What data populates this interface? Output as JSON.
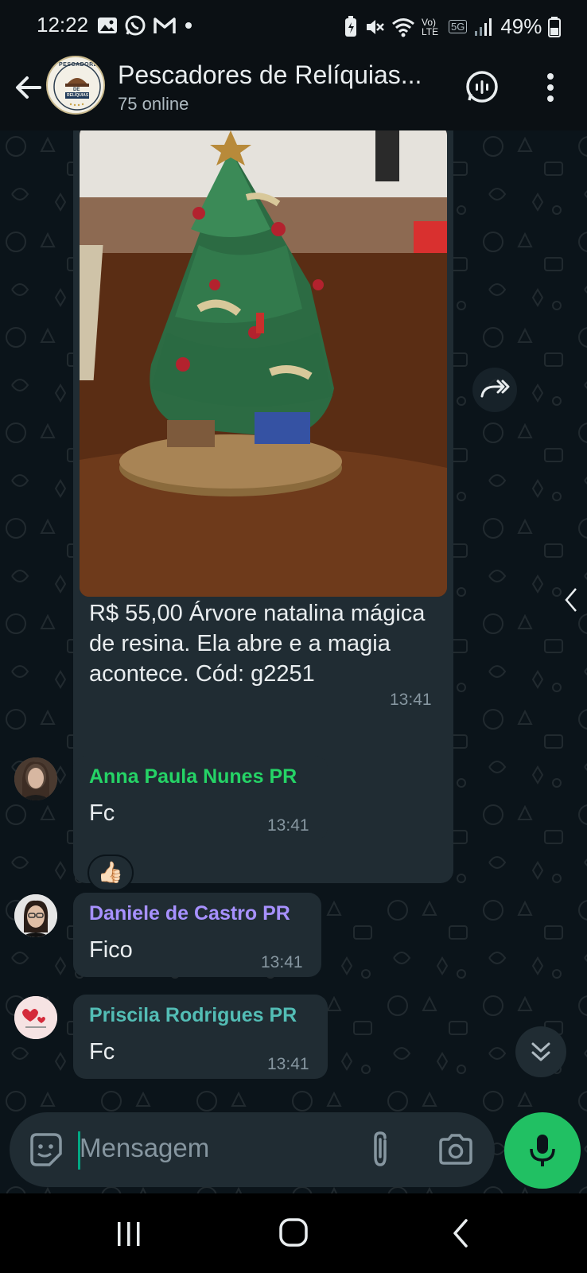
{
  "status_bar": {
    "time": "12:22",
    "battery": "49%",
    "network": "5G",
    "volte": "Vo) LTE"
  },
  "header": {
    "title": "Pescadores de Relíquias...",
    "subtitle": "75 online",
    "avatar_text_top": "PESCADORES",
    "avatar_text_mid": "DE",
    "avatar_text_bot": "RELÍQUIAS"
  },
  "messages": [
    {
      "type": "image",
      "caption": "R$ 55,00 Árvore natalina mágica de resina. Ela abre e a magia acontece.  Cód: g2251",
      "time": "13:41"
    },
    {
      "sender": "Anna Paula Nunes PR",
      "sender_color": "#25d366",
      "text": "Fc",
      "time": "13:41",
      "reaction": "👍🏻"
    },
    {
      "sender": "Daniele de Castro PR",
      "sender_color": "#a791ff",
      "text": "Fico",
      "time": "13:41"
    },
    {
      "sender": "Priscila Rodrigues PR",
      "sender_color": "#53bdb5",
      "text": "Fc",
      "time": "13:41"
    }
  ],
  "input": {
    "placeholder": "Mensagem"
  },
  "colors": {
    "accent": "#21c063",
    "bubble": "#202c33",
    "background": "#0b141a"
  }
}
